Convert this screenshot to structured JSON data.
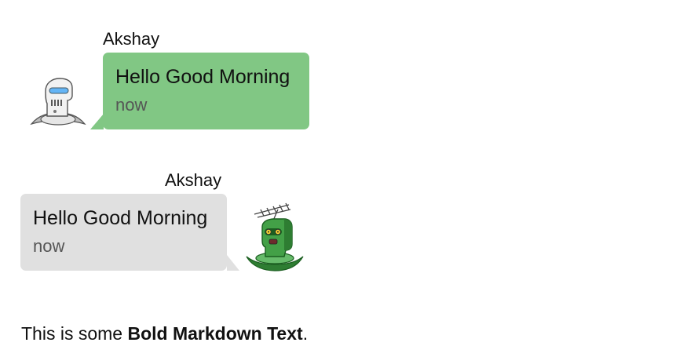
{
  "messages": [
    {
      "sender": "Akshay",
      "text": "Hello Good Morning",
      "time": "now",
      "side": "left",
      "bubble_color": "#81c784",
      "avatar_icon": "white-robot-icon"
    },
    {
      "sender": "Akshay",
      "text": "Hello Good Morning",
      "time": "now",
      "side": "right",
      "bubble_color": "#e0e0e0",
      "avatar_icon": "green-robot-icon"
    }
  ],
  "markdown": {
    "prefix": "This is some ",
    "bold": "Bold Markdown Text",
    "suffix": "."
  }
}
